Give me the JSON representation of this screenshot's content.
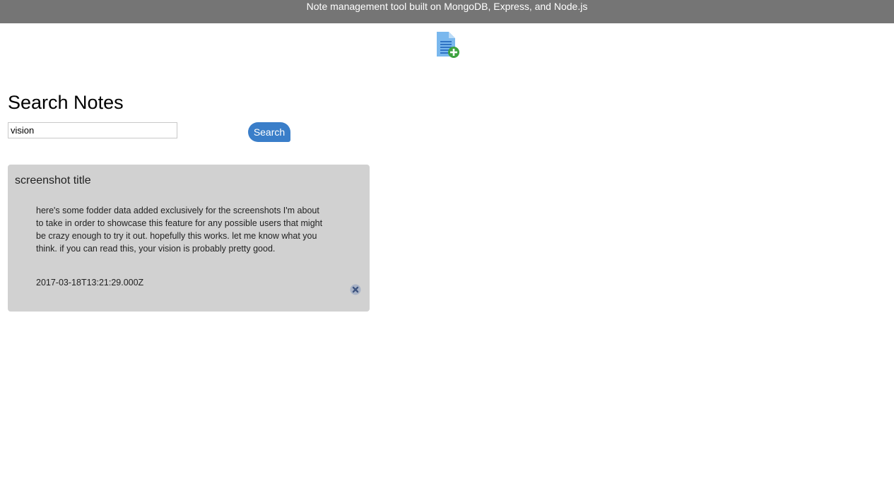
{
  "header": {
    "tagline": "Note management tool built on MongoDB, Express, and Node.js"
  },
  "add_note": {
    "icon": "add-document-icon"
  },
  "search": {
    "heading": "Search Notes",
    "input_value": "vision",
    "button_label": "Search"
  },
  "notes": [
    {
      "title": "screenshot title",
      "body": "here's some fodder data added exclusively for the screenshots I'm about to take in order to showcase this feature for any possible users that might be crazy enough to try it out. hopefully this works. let me know what you think. if you can read this, your vision is probably pretty good.",
      "date": "2017-03-18T13:21:29.000Z",
      "delete_icon": "close-icon"
    }
  ],
  "colors": {
    "header_bg": "#757575",
    "button_blue": "#3a7ec9",
    "card_bg": "#d1d1d1"
  }
}
